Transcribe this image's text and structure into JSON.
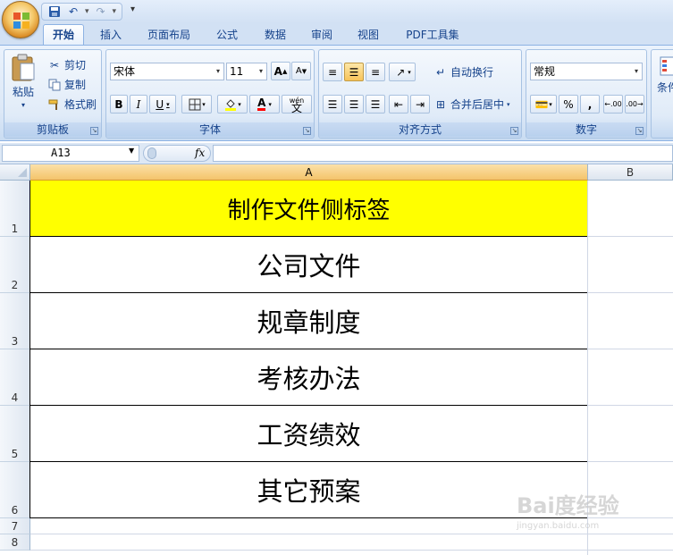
{
  "quick_access": {
    "customize_glyph": "▾"
  },
  "tabs": [
    {
      "label": "开始",
      "active": true
    },
    {
      "label": "插入"
    },
    {
      "label": "页面布局"
    },
    {
      "label": "公式"
    },
    {
      "label": "数据"
    },
    {
      "label": "审阅"
    },
    {
      "label": "视图"
    },
    {
      "label": "PDF工具集"
    }
  ],
  "ribbon": {
    "clipboard": {
      "label": "剪贴板",
      "paste": "粘贴",
      "cut": "剪切",
      "copy": "复制",
      "format_painter": "格式刷"
    },
    "font": {
      "label": "字体",
      "font_name": "宋体",
      "font_size": "11",
      "bold": "B",
      "italic": "I",
      "underline": "U",
      "grow": "A",
      "shrink": "A",
      "font_color": "A",
      "phonetic": "wén"
    },
    "alignment": {
      "label": "对齐方式",
      "wrap_text": "自动换行",
      "merge_center": "合并后居中"
    },
    "number": {
      "label": "数字",
      "format": "常规",
      "percent": "%",
      "comma": ",",
      "inc_decimal": ".00",
      "dec_decimal": ".00"
    },
    "styles": {
      "conditional_label": "条件"
    }
  },
  "formula_bar": {
    "name_box": "A13",
    "fx_label": "fx",
    "formula": ""
  },
  "sheet": {
    "columns": [
      "A",
      "B"
    ],
    "rows": [
      {
        "num": "1",
        "value": "制作文件侧标签",
        "fill": "#ffff00"
      },
      {
        "num": "2",
        "value": "公司文件"
      },
      {
        "num": "3",
        "value": "规章制度"
      },
      {
        "num": "4",
        "value": "考核办法"
      },
      {
        "num": "5",
        "value": "工资绩效"
      },
      {
        "num": "6",
        "value": "其它预案"
      },
      {
        "num": "7",
        "value": ""
      },
      {
        "num": "8",
        "value": ""
      }
    ]
  },
  "watermark": {
    "text": "Bai度经验",
    "url": "jingyan.baidu.com"
  },
  "colors": {
    "header_fill": "#ffff00",
    "ribbon_text": "#15428b",
    "selected_col": "#f4c46a"
  }
}
